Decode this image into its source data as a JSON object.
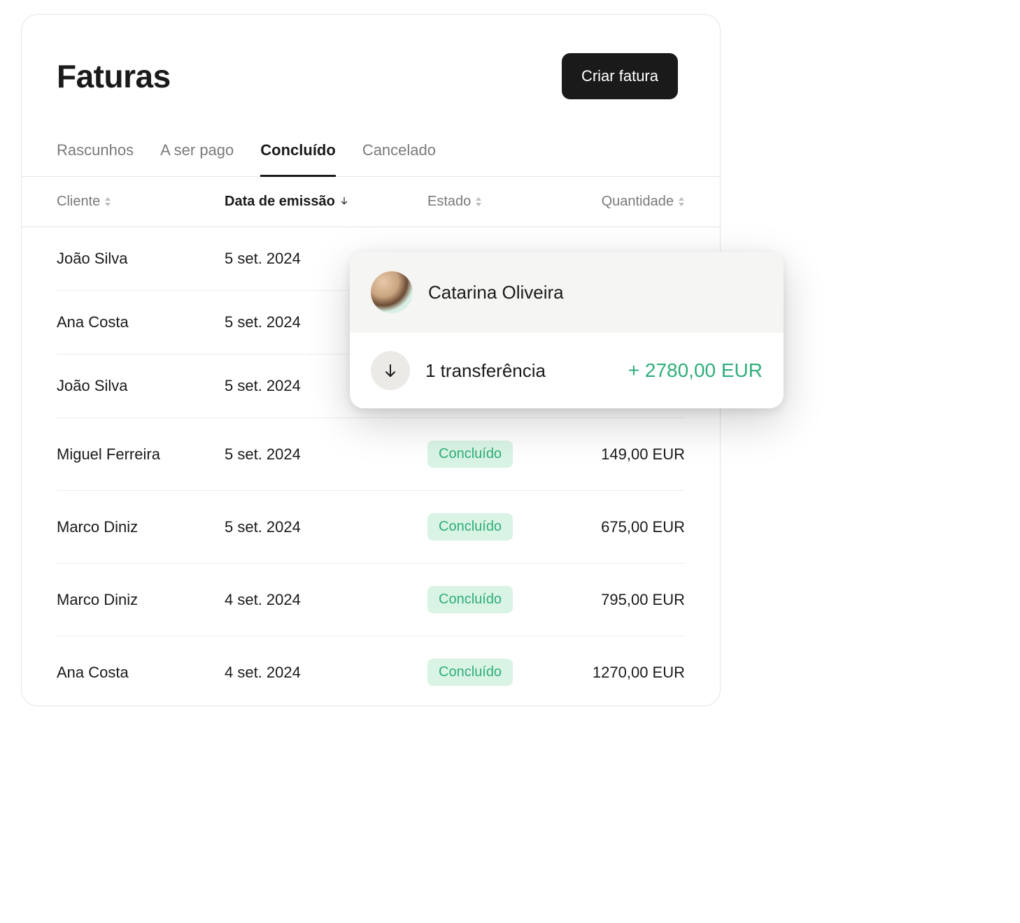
{
  "header": {
    "title": "Faturas",
    "create_button": "Criar fatura"
  },
  "tabs": [
    {
      "label": "Rascunhos",
      "active": false
    },
    {
      "label": "A ser pago",
      "active": false
    },
    {
      "label": "Concluído",
      "active": true
    },
    {
      "label": "Cancelado",
      "active": false
    }
  ],
  "columns": {
    "client": "Cliente",
    "date": "Data de emissão",
    "status": "Estado",
    "amount": "Quantidade"
  },
  "rows": [
    {
      "client": "João Silva",
      "date": "5 set. 2024",
      "status": "",
      "amount": ""
    },
    {
      "client": "Ana Costa",
      "date": "5 set. 2024",
      "status": "",
      "amount": ""
    },
    {
      "client": "João Silva",
      "date": "5 set. 2024",
      "status": "",
      "amount": ""
    },
    {
      "client": "Miguel Ferreira",
      "date": "5 set. 2024",
      "status": "Concluído",
      "amount": "149,00 EUR"
    },
    {
      "client": "Marco Diniz",
      "date": "5 set. 2024",
      "status": "Concluído",
      "amount": "675,00 EUR"
    },
    {
      "client": "Marco Diniz",
      "date": "4 set. 2024",
      "status": "Concluído",
      "amount": "795,00 EUR"
    },
    {
      "client": "Ana Costa",
      "date": "4 set. 2024",
      "status": "Concluído",
      "amount": "1270,00 EUR"
    }
  ],
  "popover": {
    "name": "Catarina Oliveira",
    "transfer_label": "1 transferência",
    "amount": "+ 2780,00 EUR"
  }
}
